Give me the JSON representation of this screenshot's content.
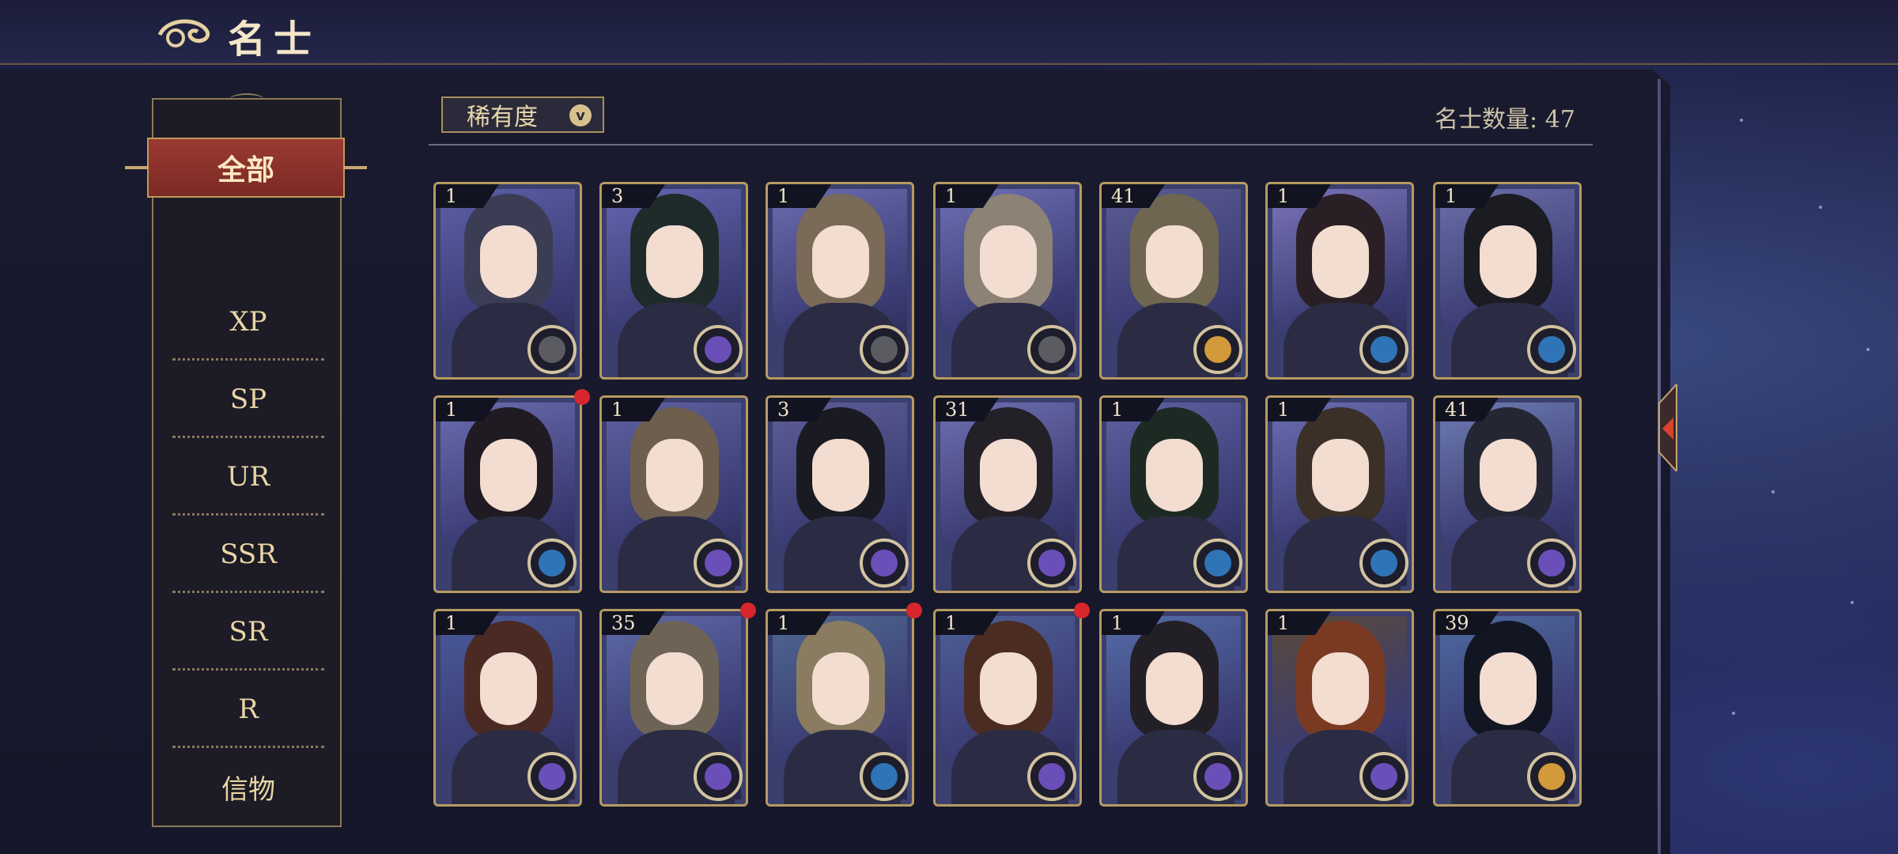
{
  "header": {
    "title": "名士"
  },
  "sidebar": {
    "items": [
      {
        "label": "全部",
        "active": true
      },
      {
        "label": "XP"
      },
      {
        "label": "SP"
      },
      {
        "label": "UR"
      },
      {
        "label": "SSR"
      },
      {
        "label": "SR"
      },
      {
        "label": "R"
      },
      {
        "label": "信物"
      }
    ]
  },
  "filter": {
    "label": "稀有度"
  },
  "count": {
    "text": "名士数量: 47"
  },
  "cards": [
    {
      "level": "1",
      "badge": "compass",
      "hair": "#3b3d55",
      "bg": "#5d5fa8"
    },
    {
      "level": "3",
      "badge": "moon",
      "hair": "#1f2a2a",
      "bg": "#6465b0"
    },
    {
      "level": "1",
      "badge": "compass",
      "hair": "#7a6a58",
      "bg": "#6a6cb0"
    },
    {
      "level": "1",
      "badge": "compass",
      "hair": "#8c8276",
      "bg": "#6d6fb4"
    },
    {
      "level": "41",
      "badge": "sun",
      "hair": "#6e6650",
      "bg": "#5a5c92"
    },
    {
      "level": "1",
      "badge": "eye",
      "hair": "#2a1f24",
      "bg": "#7a74b8"
    },
    {
      "level": "1",
      "badge": "eye",
      "hair": "#1b1b22",
      "bg": "#6b6ea8"
    },
    {
      "level": "1",
      "badge": "eye",
      "hair": "#201a22",
      "bg": "#6a6cb0",
      "dot": true
    },
    {
      "level": "1",
      "badge": "moon",
      "hair": "#6e5e4e",
      "bg": "#5f61a0"
    },
    {
      "level": "3",
      "badge": "moon",
      "hair": "#1a1a22",
      "bg": "#5d5e96"
    },
    {
      "level": "31",
      "badge": "moon",
      "hair": "#232028",
      "bg": "#6e6fb0"
    },
    {
      "level": "1",
      "badge": "eye",
      "hair": "#1d2a24",
      "bg": "#5e60a0"
    },
    {
      "level": "1",
      "badge": "eye",
      "hair": "#3a3028",
      "bg": "#6b6db2"
    },
    {
      "level": "41",
      "badge": "moon",
      "hair": "#252634",
      "bg": "#6d7cb2"
    },
    {
      "level": "1",
      "badge": "moon",
      "hair": "#4a2a22",
      "bg": "#4a5a9a"
    },
    {
      "level": "35",
      "badge": "moon",
      "hair": "#6e6456",
      "bg": "#5e6aa8",
      "dot": true
    },
    {
      "level": "1",
      "badge": "eye",
      "hair": "#8a7c60",
      "bg": "#4e6890",
      "dot": true
    },
    {
      "level": "1",
      "badge": "moon",
      "hair": "#4a2c22",
      "bg": "#4e5e96",
      "dot": true
    },
    {
      "level": "1",
      "badge": "moon",
      "hair": "#231f26",
      "bg": "#556ca8"
    },
    {
      "level": "1",
      "badge": "moon",
      "hair": "#7a3a22",
      "bg": "#5a4a3a"
    },
    {
      "level": "39",
      "badge": "sun",
      "hair": "#121622",
      "bg": "#4e6aa0"
    }
  ],
  "badges": {
    "compass": "#5a5c62",
    "moon": "#6a4fb8",
    "sun": "#d29a3a",
    "eye": "#2f74b6"
  }
}
